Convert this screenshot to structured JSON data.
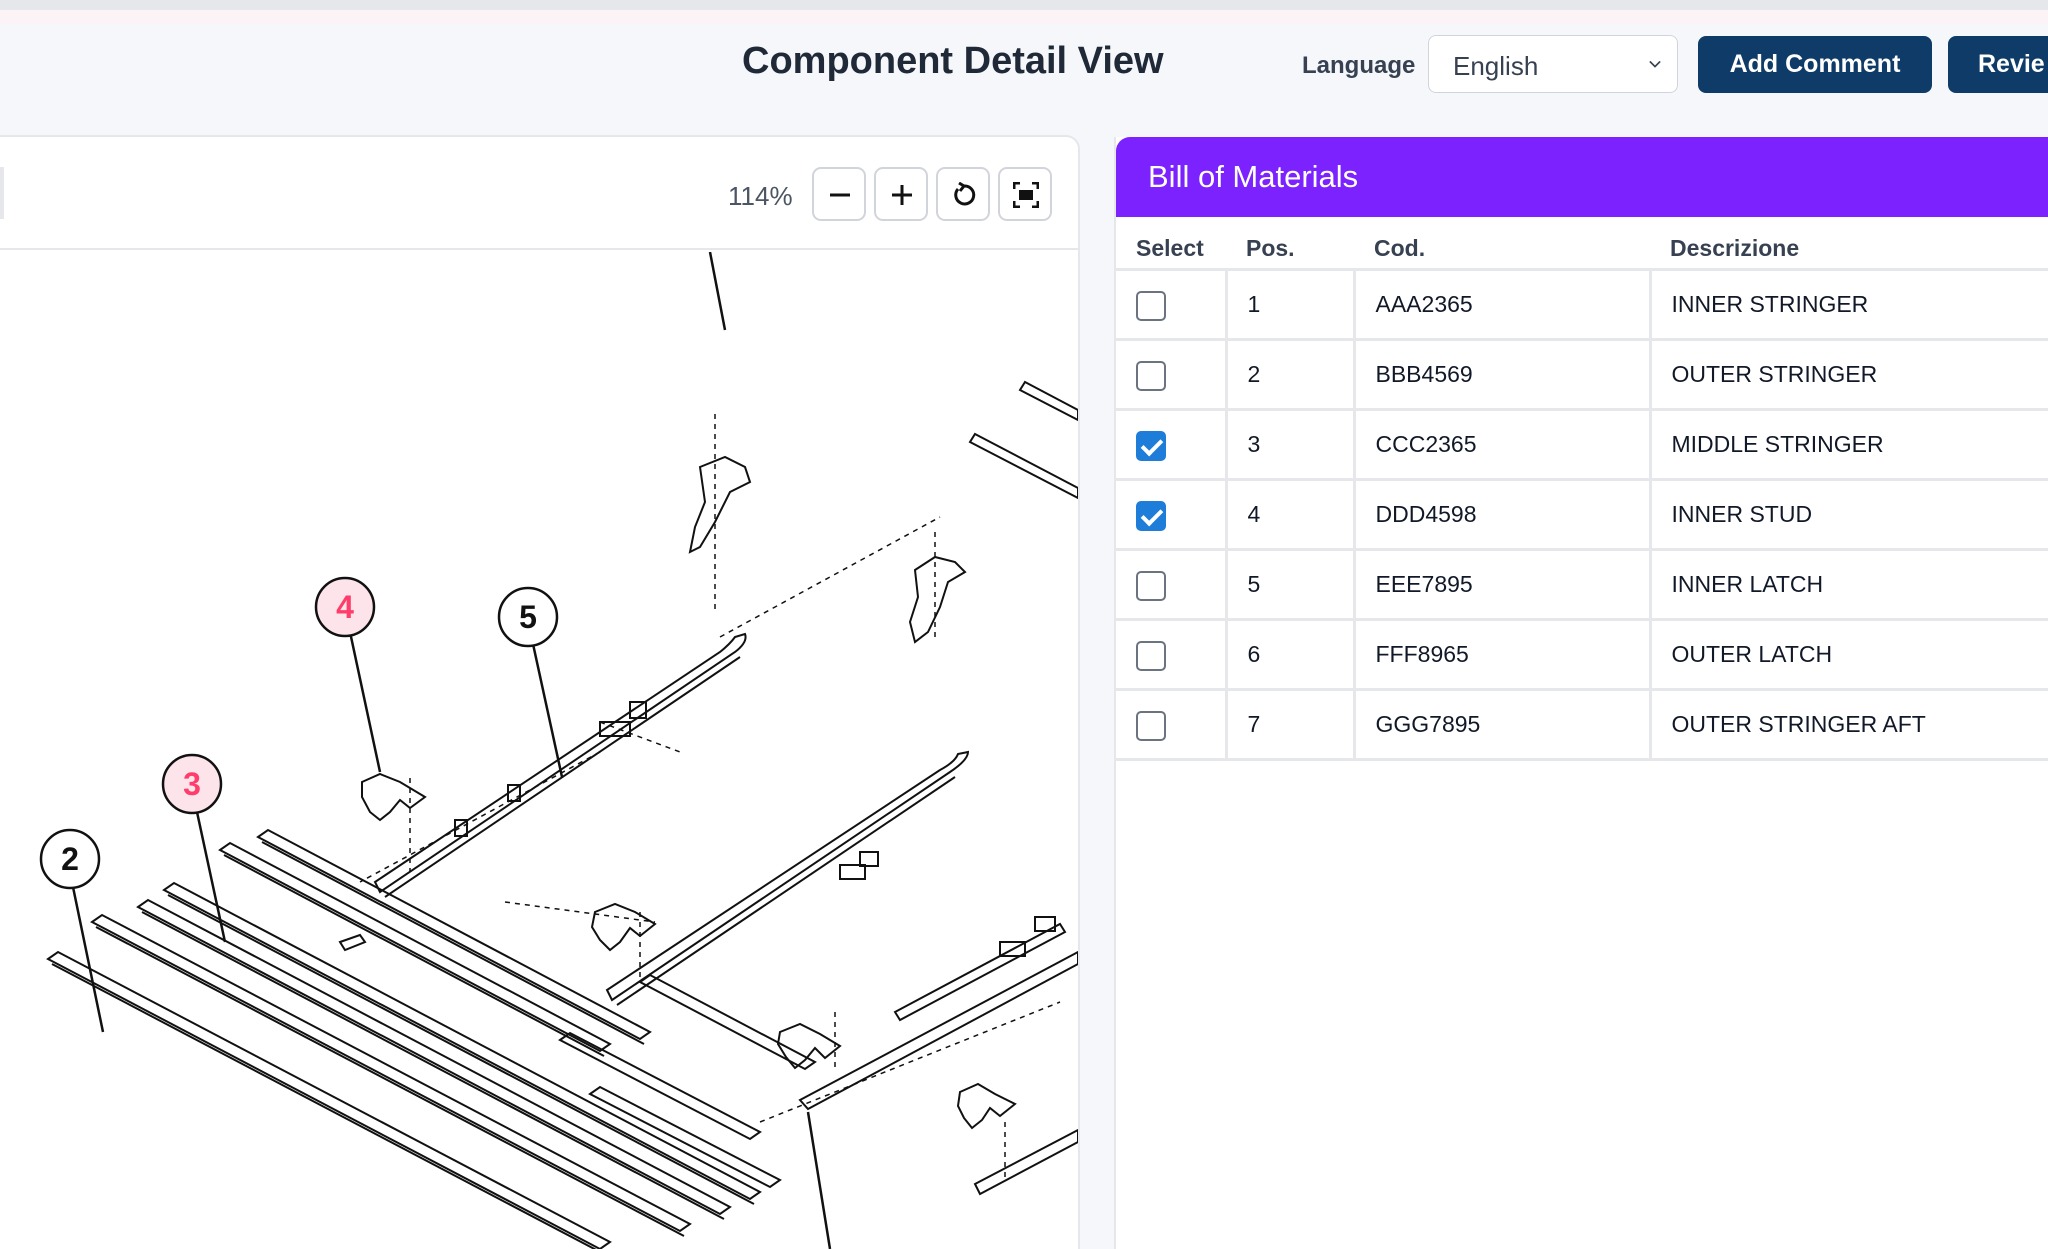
{
  "header": {
    "title": "Component Detail View",
    "language_label": "Language",
    "language_value": "English",
    "add_comment_label": "Add Comment",
    "review_label": "Revie"
  },
  "viewer": {
    "zoom": "114%",
    "callouts": [
      "4",
      "5",
      "3",
      "2"
    ]
  },
  "bom": {
    "title": "Bill of Materials",
    "columns": [
      "Select",
      "Pos.",
      "Cod.",
      "Descrizione"
    ],
    "rows": [
      {
        "selected": false,
        "pos": "1",
        "cod": "AAA2365",
        "desc": "INNER STRINGER"
      },
      {
        "selected": false,
        "pos": "2",
        "cod": "BBB4569",
        "desc": "OUTER STRINGER"
      },
      {
        "selected": true,
        "pos": "3",
        "cod": "CCC2365",
        "desc": "MIDDLE STRINGER"
      },
      {
        "selected": true,
        "pos": "4",
        "cod": "DDD4598",
        "desc": "INNER STUD"
      },
      {
        "selected": false,
        "pos": "5",
        "cod": "EEE7895",
        "desc": "INNER LATCH"
      },
      {
        "selected": false,
        "pos": "6",
        "cod": "FFF8965",
        "desc": "OUTER LATCH"
      },
      {
        "selected": false,
        "pos": "7",
        "cod": "GGG7895",
        "desc": "OUTER STRINGER AFT"
      }
    ]
  },
  "colors": {
    "primary_button": "#0f3b68",
    "bom_header": "#7b22ff",
    "highlight_callout": "#ff3d6b",
    "checkbox_checked": "#1d7dd8"
  }
}
